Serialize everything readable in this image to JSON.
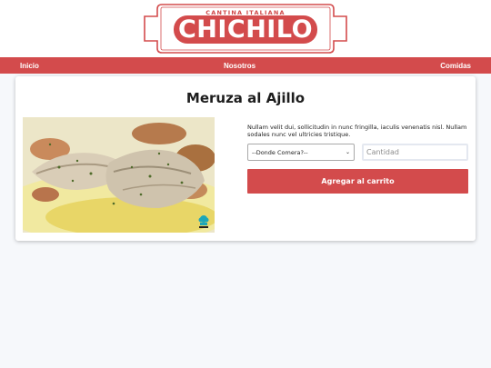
{
  "brand": {
    "tagline": "CANTINA ITALIANA",
    "name": "CHICHILO",
    "accent_color": "#d34b4c"
  },
  "nav": {
    "items": [
      {
        "label": "Inicio"
      },
      {
        "label": "Nosotros"
      },
      {
        "label": "Comidas"
      }
    ]
  },
  "product": {
    "title": "Meruza al Ajillo",
    "image_icon": "chef-hat-icon",
    "description": "Nullam velit dui, sollicitudin in nunc fringilla, iaculis venenatis nisl. Nullam sodales nunc vel ultricies tristique.",
    "location_select": {
      "selected": "--Donde Comera?--"
    },
    "quantity": {
      "placeholder": "Cantidad"
    },
    "add_button_label": "Agregar al carrito"
  }
}
